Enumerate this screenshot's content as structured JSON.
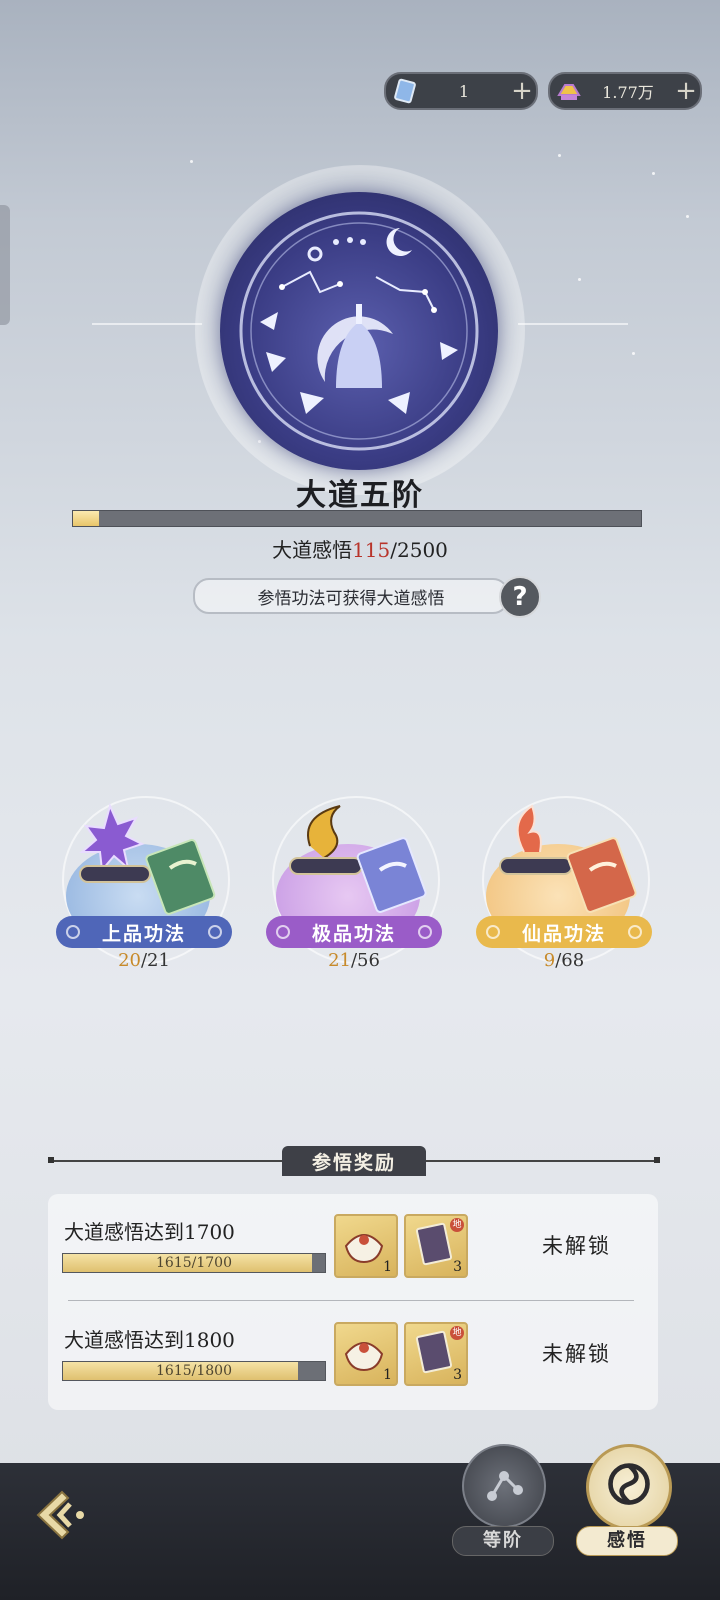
{
  "currency": [
    {
      "icon": "scroll-ticket-icon",
      "value": "1"
    },
    {
      "icon": "gold-ingot-icon",
      "value": "1.77万"
    }
  ],
  "header": {
    "title": "大道五阶",
    "progress_fraction": 0.046,
    "insight_label": "大道感悟",
    "insight_current": "115",
    "insight_total": "/2500",
    "hint": "参悟功法可获得大道感悟"
  },
  "techniques": [
    {
      "label": "上品功法",
      "got": "20",
      "total": "/21",
      "color": "#4f66b8"
    },
    {
      "label": "极品功法",
      "got": "21",
      "total": "/56",
      "color": "#9a5cc8"
    },
    {
      "label": "仙品功法",
      "got": "9",
      "total": "/68",
      "color": "#e9b94c"
    }
  ],
  "rewards": {
    "title": "参悟奖励",
    "rows": [
      {
        "label": "大道感悟达到1700",
        "progress": "1615/1700",
        "fraction": 0.95,
        "items": [
          {
            "icon": "treasure-bag-icon",
            "qty": "1"
          },
          {
            "icon": "manual-book-icon",
            "qty": "3",
            "tag": "地"
          }
        ],
        "status": "未解锁"
      },
      {
        "label": "大道感悟达到1800",
        "progress": "1615/1800",
        "fraction": 0.897,
        "items": [
          {
            "icon": "treasure-bag-icon",
            "qty": "1"
          },
          {
            "icon": "manual-book-icon",
            "qty": "3",
            "tag": "地"
          }
        ],
        "status": "未解锁"
      }
    ]
  },
  "nav": [
    {
      "label": "等阶",
      "icon": "constellation-icon"
    },
    {
      "label": "感悟",
      "icon": "swirl-icon"
    }
  ]
}
